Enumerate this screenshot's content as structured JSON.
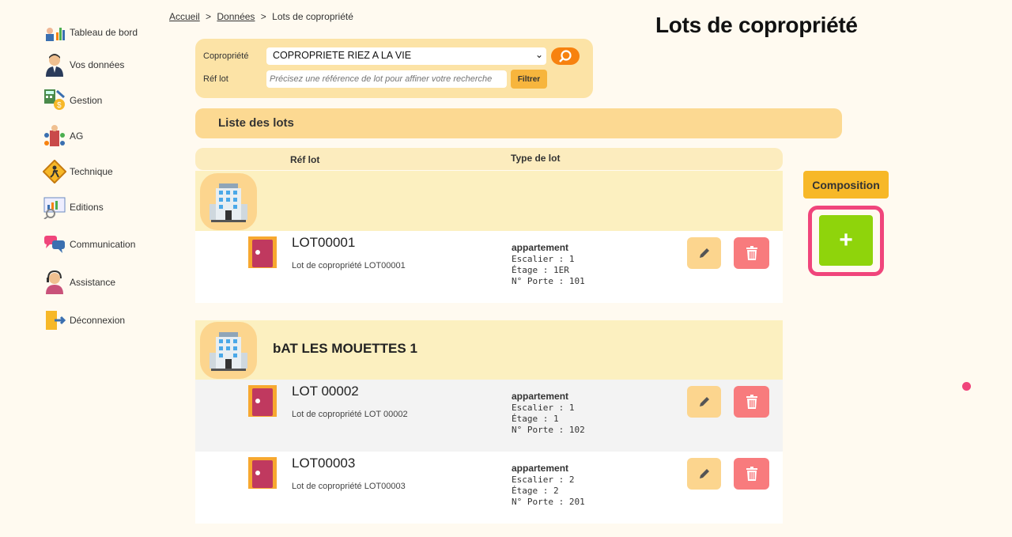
{
  "sidebar": {
    "items": [
      {
        "label": "Tableau de bord",
        "icon": "dashboard-icon"
      },
      {
        "label": "Vos données",
        "icon": "user-icon"
      },
      {
        "label": "Gestion",
        "icon": "calculator-icon"
      },
      {
        "label": "AG",
        "icon": "meeting-icon"
      },
      {
        "label": "Technique",
        "icon": "technician-icon"
      },
      {
        "label": "Editions",
        "icon": "report-icon"
      },
      {
        "label": "Communication",
        "icon": "chat-icon"
      },
      {
        "label": "Assistance",
        "icon": "support-icon"
      },
      {
        "label": "Déconnexion",
        "icon": "logout-icon"
      }
    ]
  },
  "breadcrumb": {
    "home": "Accueil",
    "data": "Données",
    "current": "Lots de copropriété",
    "separator": ">"
  },
  "page_title": "Lots de copropriété",
  "filter": {
    "copro_label": "Copropriété",
    "copro_value": "COPROPRIETE RIEZ A LA VIE",
    "reflot_label": "Réf lot",
    "reflot_placeholder": "Précisez une référence de lot pour affiner votre recherche",
    "filter_button": "Filtrer"
  },
  "list_header": "Liste des lots",
  "columns": {
    "ref": "Réf lot",
    "type": "Type de lot"
  },
  "buildings": [
    {
      "name": "",
      "lots": [
        {
          "name": "LOT00001",
          "desc": "Lot de copropriété LOT00001",
          "type": "appartement",
          "escalier": "Escalier : 1",
          "etage": "Étage : 1ER",
          "porte": "N° Porte : 101"
        }
      ]
    },
    {
      "name": "bAT LES MOUETTES 1",
      "lots": [
        {
          "name": "LOT 00002",
          "desc": "Lot de copropriété LOT 00002",
          "type": "appartement",
          "escalier": "Escalier : 1",
          "etage": "Étage : 1",
          "porte": "N° Porte : 102"
        },
        {
          "name": "LOT00003",
          "desc": "Lot de copropriété LOT00003",
          "type": "appartement",
          "escalier": "Escalier : 2",
          "etage": "Étage : 2",
          "porte": "N° Porte : 201"
        }
      ]
    }
  ],
  "composition_button": "Composition",
  "add_button": "+",
  "colors": {
    "accent": "#f7820f",
    "add": "#8fd40b",
    "highlight": "#f0457b",
    "delete": "#f87b7d",
    "edit": "#fcd58e"
  }
}
